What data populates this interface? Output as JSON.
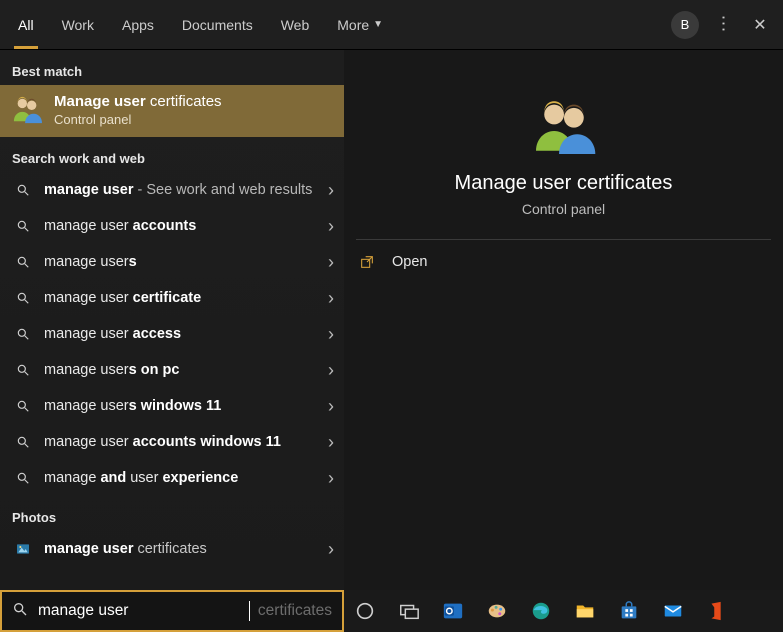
{
  "tabs": {
    "items": [
      "All",
      "Work",
      "Apps",
      "Documents",
      "Web",
      "More"
    ],
    "active_index": 0
  },
  "header": {
    "avatar_initial": "B"
  },
  "sections": {
    "best_match": "Best match",
    "search_work_web": "Search work and web",
    "photos": "Photos"
  },
  "best_match": {
    "title_prefix": "Manage user",
    "title_suffix": " certificates",
    "subtitle": "Control panel"
  },
  "results": [
    {
      "html": "<b>manage user</b><span class='suffix-grey'> - See work and web results</span>"
    },
    {
      "html": "manage user <b>accounts</b>"
    },
    {
      "html": "manage user<b>s</b>"
    },
    {
      "html": "manage user <b>certificate</b>"
    },
    {
      "html": "manage user <b>access</b>"
    },
    {
      "html": "manage user<b>s on pc</b>"
    },
    {
      "html": "manage user<b>s windows 11</b>"
    },
    {
      "html": "manage user <b>accounts windows 11</b>"
    },
    {
      "html": "manage <b>and</b> user <b>experience</b>"
    }
  ],
  "photos_result": {
    "html": "<b>manage user</b><span class='thin'> certificates</span>"
  },
  "detail": {
    "title": "Manage user certificates",
    "subtitle": "Control panel",
    "action_open": "Open"
  },
  "search": {
    "query": "manage user",
    "ghost_completion": "certificates"
  },
  "colors": {
    "accent": "#d5a03a",
    "bestmatch_bg": "#806a38"
  }
}
